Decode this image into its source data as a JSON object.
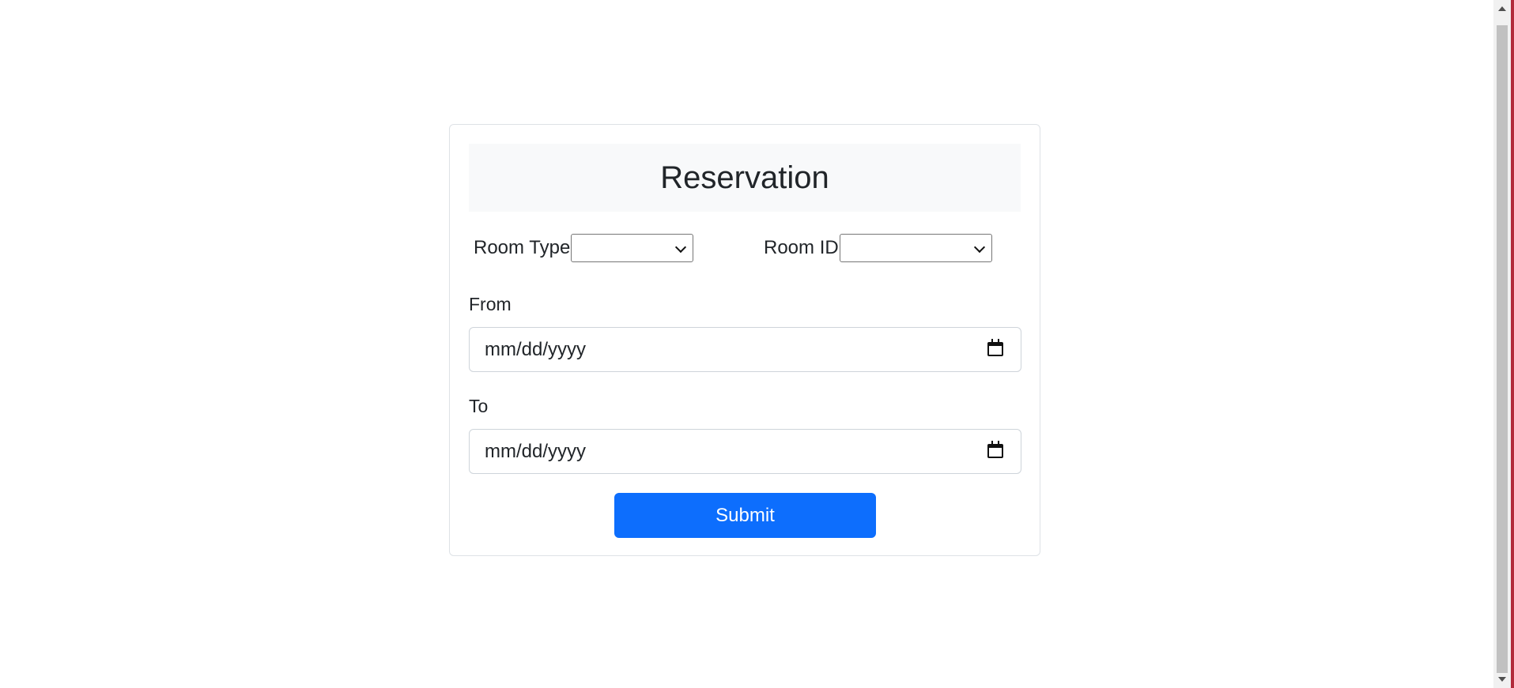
{
  "form": {
    "title": "Reservation",
    "room_type_label": "Room Type",
    "room_type_value": "",
    "room_id_label": "Room ID",
    "room_id_value": "",
    "from_label": "From",
    "from_placeholder": "mm/dd/yyyy",
    "to_label": "To",
    "to_placeholder": "mm/dd/yyyy",
    "submit_label": "Submit"
  },
  "colors": {
    "primary": "#0d6efd",
    "header_bg": "#f8f9fa",
    "text": "#212529",
    "border": "#dee2e6"
  },
  "icons": {
    "date_picker": "calendar-icon",
    "select": "chevron-down-icon"
  }
}
